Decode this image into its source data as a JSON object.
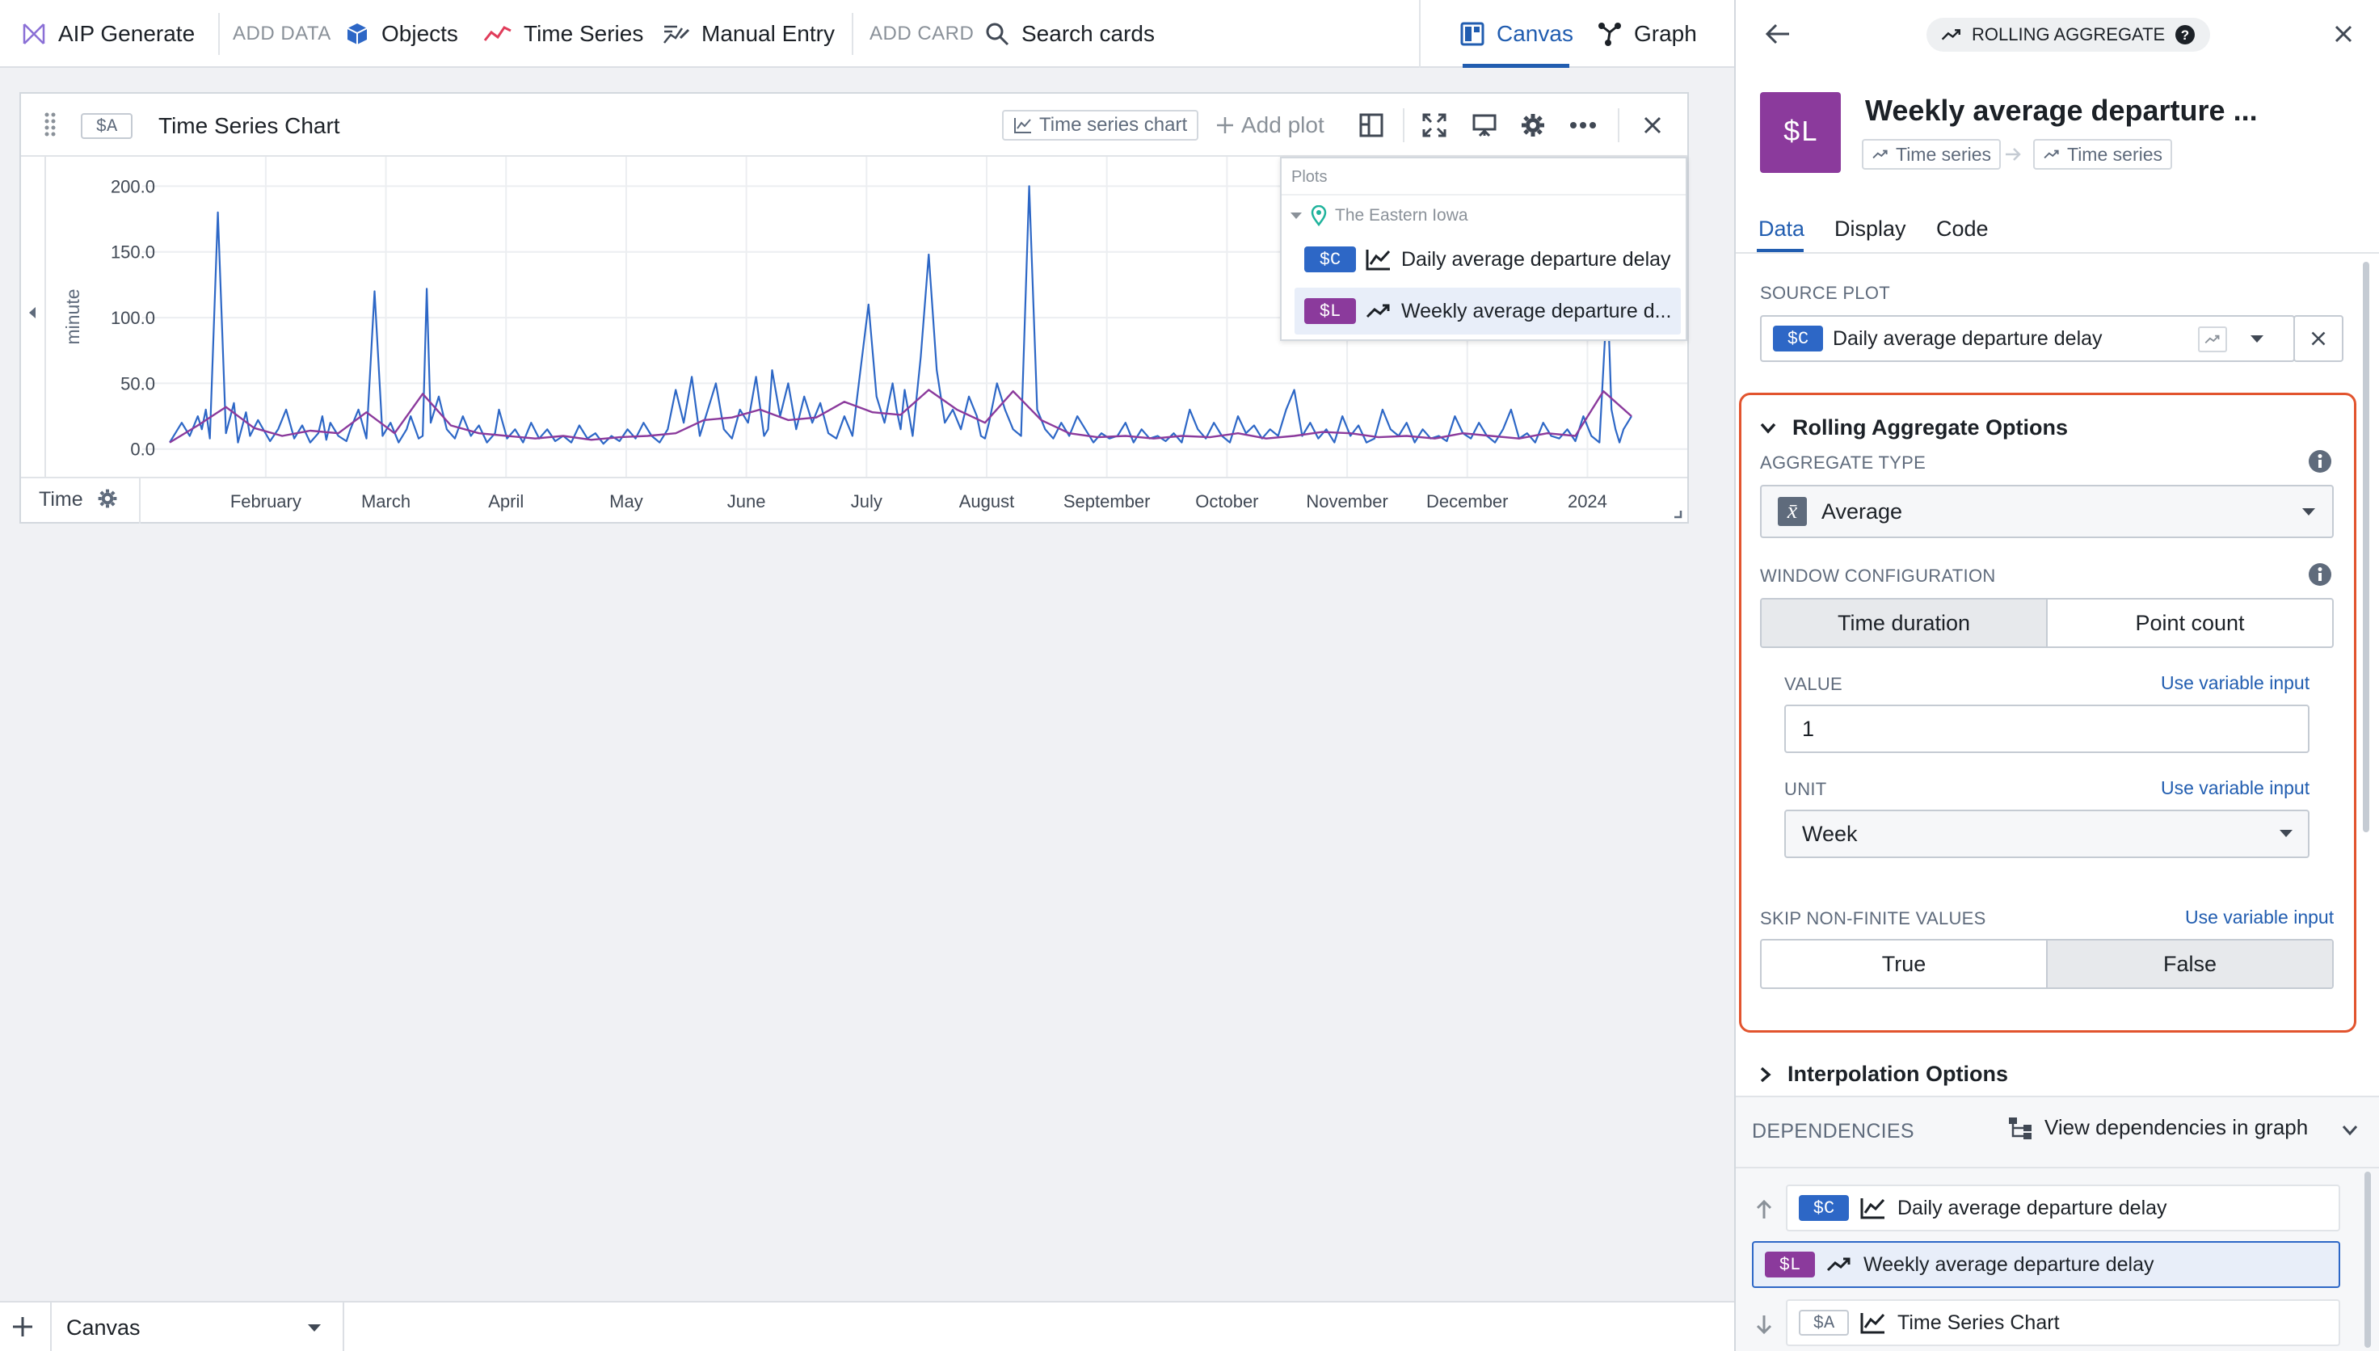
{
  "toolbar": {
    "aip_generate": "AIP Generate",
    "add_data": "ADD DATA",
    "objects": "Objects",
    "time_series": "Time Series",
    "manual_entry": "Manual Entry",
    "add_card": "ADD CARD",
    "search_cards": "Search cards",
    "canvas": "Canvas",
    "graph": "Graph",
    "accent": "#215db0"
  },
  "card": {
    "tag": "$A",
    "title": "Time Series Chart",
    "chart_type_btn": "Time series chart",
    "add_plot": "Add plot"
  },
  "legend": {
    "header": "Plots",
    "group": "The Eastern Iowa",
    "items": [
      {
        "tag": "$C",
        "label": "Daily average departure delay",
        "color": "#2d67c6"
      },
      {
        "tag": "$L",
        "label": "Weekly average departure d...",
        "color": "#8b3a9c"
      }
    ]
  },
  "chart_data": {
    "type": "line",
    "ylabel": "minute",
    "yticks": [
      "200.0",
      "150.0",
      "100.0",
      "50.0",
      "0.0"
    ],
    "ylim": [
      -10,
      215
    ],
    "xlabel": "Time",
    "xticks": [
      "February",
      "March",
      "April",
      "May",
      "June",
      "July",
      "August",
      "September",
      "October",
      "November",
      "December",
      "2024"
    ],
    "x_domain_days": [
      0,
      365
    ],
    "series": [
      {
        "name": "Daily average departure delay",
        "color": "#2d67c6",
        "x": [
          0,
          3,
          5,
          7,
          8,
          9,
          10,
          12,
          14,
          16,
          17,
          19,
          20,
          22,
          25,
          27,
          29,
          31,
          33,
          35,
          37,
          38,
          39,
          40,
          42,
          44,
          45,
          47,
          49,
          51,
          53,
          55,
          57,
          59,
          60,
          62,
          63,
          64,
          65,
          67,
          69,
          71,
          73,
          75,
          77,
          79,
          81,
          82,
          84,
          86,
          87,
          88,
          90,
          92,
          94,
          96,
          98,
          100,
          102,
          104,
          106,
          108,
          110,
          112,
          114,
          116,
          118,
          120,
          122,
          124,
          126,
          128,
          130,
          132,
          134,
          136,
          138,
          140,
          142,
          144,
          146,
          148,
          149,
          150,
          152,
          154,
          156,
          158,
          160,
          162,
          164,
          166,
          168,
          170,
          172,
          174,
          176,
          178,
          180,
          181,
          182,
          183,
          185,
          187,
          189,
          191,
          193,
          195,
          197,
          199,
          201,
          202,
          203,
          204,
          206,
          208,
          210,
          212,
          214,
          216,
          218,
          220,
          222,
          224,
          226,
          228,
          230,
          232,
          234,
          236,
          238,
          240,
          242,
          244,
          246,
          248,
          250,
          252,
          254,
          256,
          258,
          260,
          262,
          264,
          266,
          268,
          270,
          272,
          274,
          276,
          278,
          280,
          282,
          284,
          286,
          288,
          290,
          292,
          294,
          296,
          298,
          300,
          302,
          304,
          306,
          308,
          310,
          312,
          314,
          316,
          318,
          320,
          322,
          324,
          326,
          328,
          330,
          332,
          334,
          336,
          338,
          340,
          342,
          344,
          346,
          348,
          350,
          352,
          354,
          356,
          358,
          359,
          360,
          361,
          362,
          364
        ],
        "y": [
          5,
          20,
          10,
          25,
          15,
          30,
          8,
          180,
          12,
          35,
          5,
          28,
          10,
          22,
          6,
          15,
          30,
          8,
          18,
          5,
          12,
          25,
          7,
          20,
          10,
          6,
          15,
          30,
          8,
          120,
          10,
          20,
          5,
          15,
          25,
          8,
          10,
          122,
          20,
          40,
          15,
          8,
          25,
          10,
          18,
          5,
          12,
          30,
          8,
          15,
          10,
          5,
          20,
          8,
          15,
          6,
          10,
          5,
          18,
          8,
          12,
          4,
          10,
          6,
          15,
          8,
          20,
          10,
          5,
          15,
          45,
          20,
          55,
          10,
          30,
          50,
          15,
          8,
          30,
          20,
          55,
          10,
          15,
          60,
          25,
          50,
          15,
          40,
          20,
          35,
          12,
          8,
          25,
          10,
          60,
          110,
          40,
          20,
          50,
          30,
          15,
          45,
          10,
          70,
          148,
          60,
          20,
          30,
          15,
          40,
          25,
          10,
          8,
          20,
          50,
          30,
          15,
          10,
          200,
          30,
          15,
          8,
          20,
          10,
          25,
          15,
          5,
          12,
          8,
          10,
          20,
          5,
          15,
          8,
          10,
          6,
          12,
          5,
          30,
          15,
          8,
          20,
          10,
          5,
          25,
          12,
          18,
          8,
          15,
          10,
          30,
          45,
          10,
          20,
          8,
          15,
          5,
          25,
          10,
          18,
          5,
          8,
          30,
          15,
          10,
          20,
          5,
          15,
          8,
          10,
          6,
          25,
          12,
          8,
          20,
          10,
          5,
          15,
          30,
          8,
          12,
          5,
          20,
          10,
          8,
          15,
          6,
          25,
          10,
          5,
          120,
          30,
          15,
          5,
          15,
          25
        ]
      },
      {
        "name": "Weekly average departure delay",
        "color": "#8b3a9c",
        "x": [
          0,
          7,
          14,
          21,
          28,
          35,
          42,
          49,
          56,
          63,
          70,
          77,
          84,
          91,
          98,
          105,
          112,
          119,
          126,
          133,
          140,
          147,
          154,
          161,
          168,
          175,
          182,
          189,
          196,
          203,
          210,
          217,
          224,
          231,
          238,
          245,
          252,
          259,
          266,
          273,
          280,
          287,
          294,
          301,
          308,
          315,
          322,
          329,
          336,
          343,
          350,
          357,
          364
        ],
        "y": [
          5,
          18,
          32,
          16,
          10,
          14,
          12,
          28,
          12,
          42,
          18,
          12,
          10,
          8,
          10,
          7,
          9,
          10,
          12,
          22,
          24,
          30,
          22,
          24,
          36,
          28,
          26,
          45,
          30,
          20,
          44,
          22,
          12,
          9,
          10,
          8,
          10,
          9,
          12,
          8,
          10,
          13,
          12,
          9,
          10,
          8,
          12,
          10,
          8,
          12,
          10,
          44,
          25
        ]
      }
    ]
  },
  "panel": {
    "header_type": "ROLLING AGGREGATE",
    "title_tag": "$L",
    "title": "Weekly average departure ...",
    "chip_from": "Time series",
    "chip_to": "Time series",
    "tabs": [
      "Data",
      "Display",
      "Code"
    ],
    "source_plot_label": "SOURCE PLOT",
    "source_tag": "$C",
    "source_value": "Daily average departure delay",
    "rolling_title": "Rolling Aggregate Options",
    "aggregate_type_label": "AGGREGATE TYPE",
    "aggregate_value": "Average",
    "aggregate_icon_glyph": "x̄",
    "window_label": "WINDOW CONFIGURATION",
    "window_opts": [
      "Time duration",
      "Point count"
    ],
    "value_label": "VALUE",
    "value_link": "Use variable input",
    "value": "1",
    "unit_label": "UNIT",
    "unit_link": "Use variable input",
    "unit_value": "Week",
    "skip_label": "SKIP NON-FINITE VALUES",
    "skip_link": "Use variable input",
    "skip_opts": [
      "True",
      "False"
    ],
    "interp_title": "Interpolation Options",
    "deps_label": "DEPENDENCIES",
    "deps_link": "View dependencies in graph",
    "deps": [
      {
        "tag": "$C",
        "label": "Daily average departure delay"
      },
      {
        "tag": "$L",
        "label": "Weekly average departure delay"
      },
      {
        "tag": "$A",
        "label": "Time Series Chart"
      }
    ],
    "highlight_color": "#e2542e"
  },
  "bottom": {
    "tab": "Canvas"
  }
}
